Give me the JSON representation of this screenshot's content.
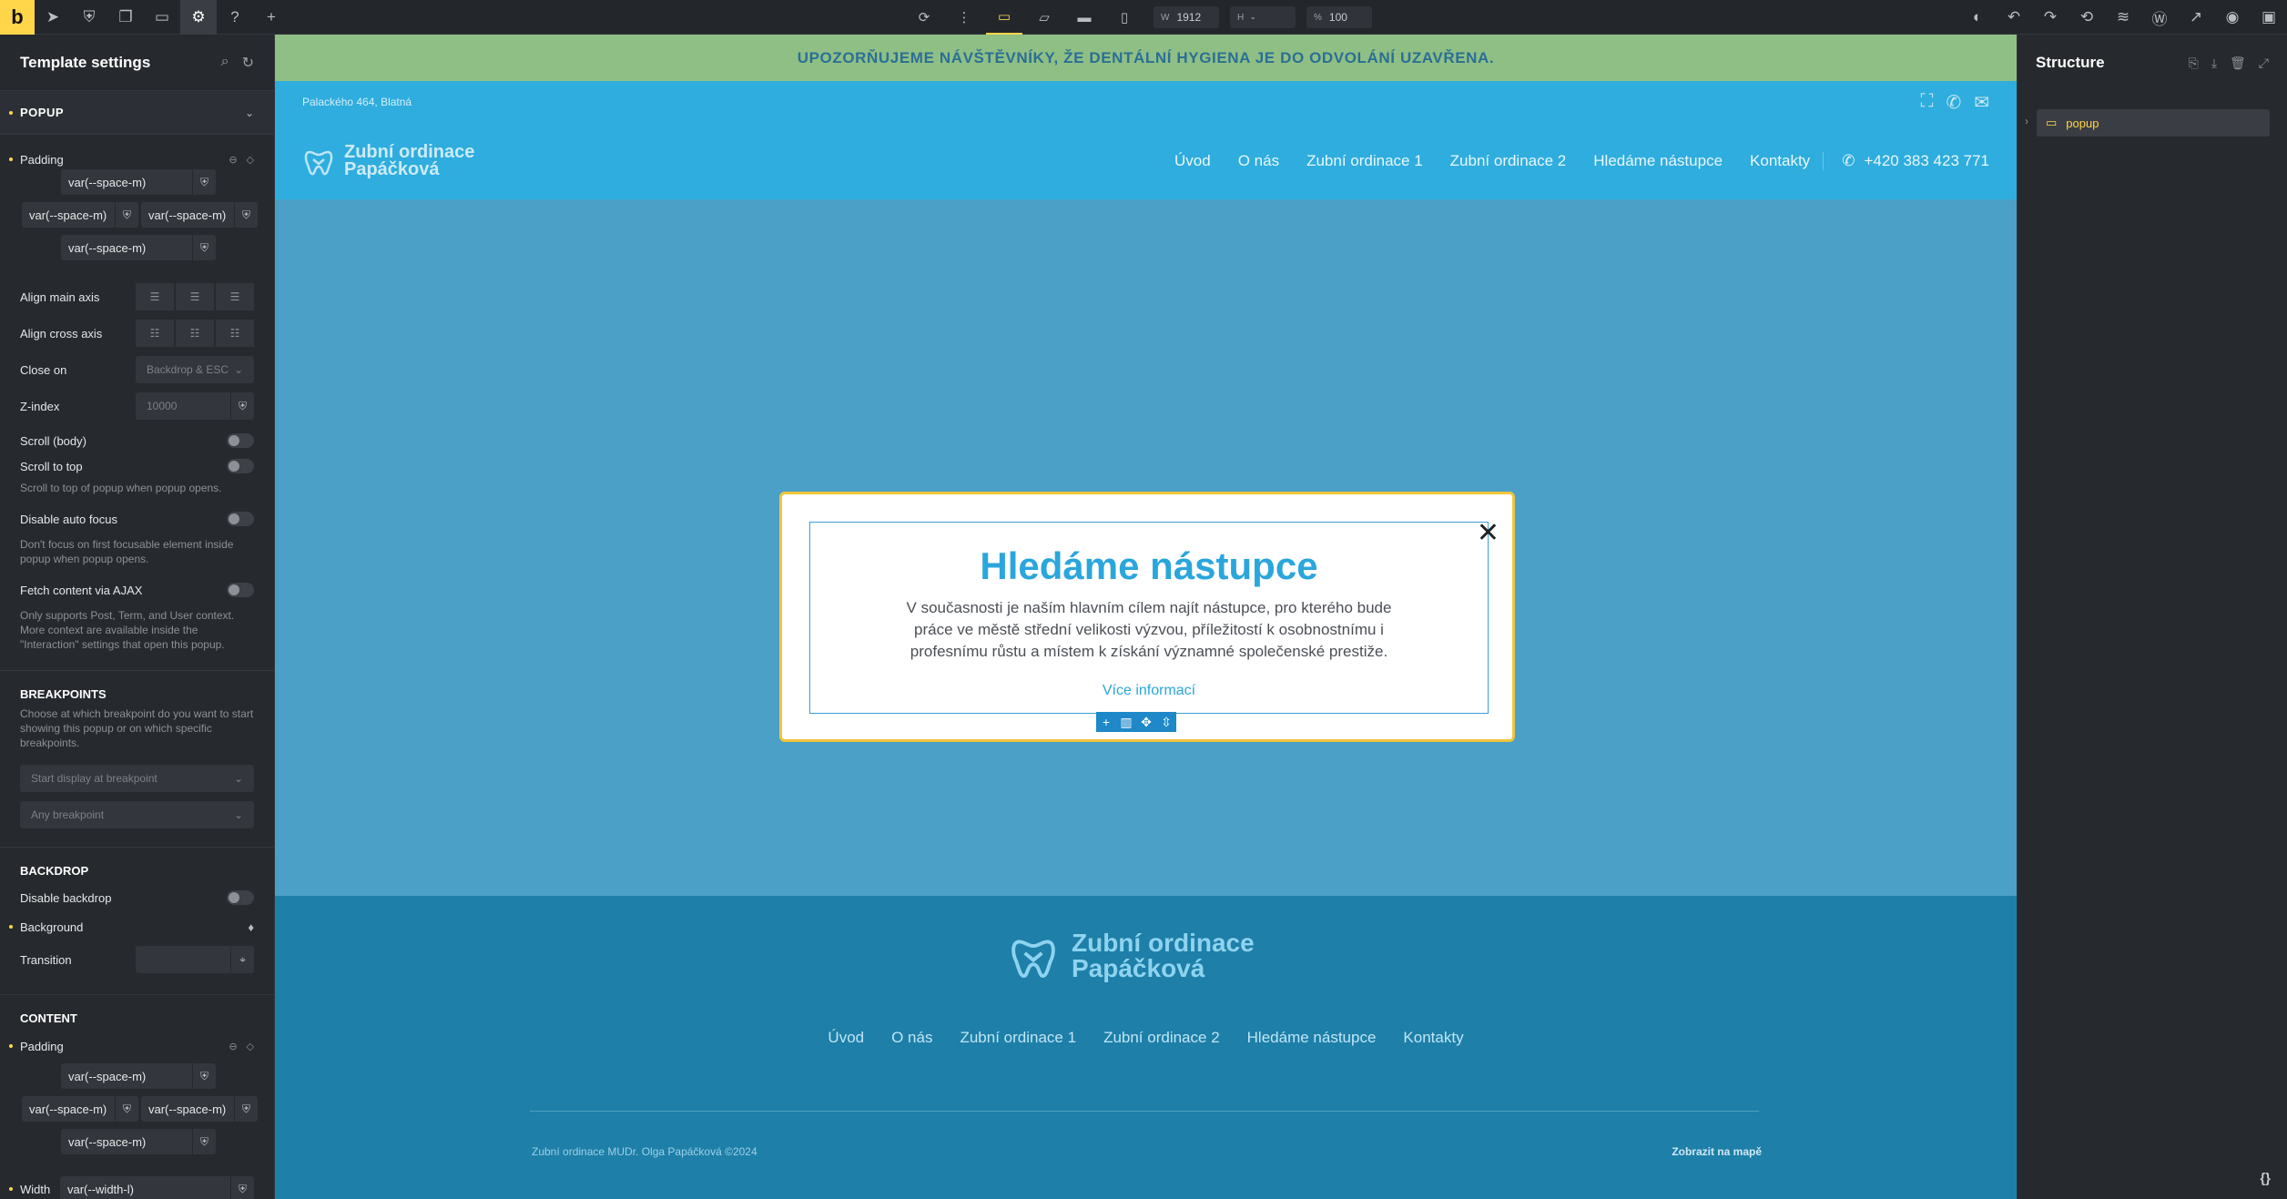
{
  "toolbar": {
    "logo": "b",
    "width_label": "W",
    "width_value": "1912",
    "height_label": "H",
    "height_value": "-",
    "zoom_label": "%",
    "zoom_value": "100"
  },
  "left_panel": {
    "title": "Template settings",
    "popup_section": "POPUP",
    "padding_label": "Padding",
    "padding_values": [
      "var(--space-m)",
      "var(--space-m)",
      "var(--space-m)",
      "var(--space-m)"
    ],
    "align_main_label": "Align main axis",
    "align_cross_label": "Align cross axis",
    "close_on_label": "Close on",
    "close_on_value": "Backdrop & ESC",
    "zindex_label": "Z-index",
    "zindex_placeholder": "10000",
    "scroll_body_label": "Scroll (body)",
    "scroll_top_label": "Scroll to top",
    "scroll_top_desc": "Scroll to top of popup when popup opens.",
    "disable_focus_label": "Disable auto focus",
    "disable_focus_desc": "Don't focus on first focusable element inside popup when popup opens.",
    "fetch_ajax_label": "Fetch content via AJAX",
    "fetch_ajax_desc": "Only supports Post, Term, and User context. More context are available inside the \"Interaction\" settings that open this popup.",
    "breakpoints_title": "BREAKPOINTS",
    "breakpoints_desc": "Choose at which breakpoint do you want to start showing this popup or on which specific breakpoints.",
    "start_breakpoint_placeholder": "Start display at breakpoint",
    "any_breakpoint_placeholder": "Any breakpoint",
    "backdrop_title": "BACKDROP",
    "disable_backdrop_label": "Disable backdrop",
    "background_label": "Background",
    "transition_label": "Transition",
    "content_title": "CONTENT",
    "content_padding_label": "Padding",
    "content_padding_values": [
      "var(--space-m)",
      "var(--space-m)",
      "var(--space-m)",
      "var(--space-m)"
    ],
    "width_label": "Width",
    "width_value": "var(--width-l)"
  },
  "site": {
    "notice": "UPOZORŇUJEME NÁVŠTĚVNÍKY, ŽE DENTÁLNÍ HYGIENA JE DO ODVOLÁNÍ UZAVŘENA.",
    "address": "Palackého 464, Blatná",
    "brand_line1": "Zubní ordinace",
    "brand_line2": "Papáčková",
    "menu": [
      "Úvod",
      "O nás",
      "Zubní ordinace 1",
      "Zubní ordinace 2",
      "Hledáme nástupce",
      "Kontakty"
    ],
    "phone": "+420 383 423 771",
    "popup_title": "Hledáme nástupce",
    "popup_text": "V současnosti je naším hlavním cílem najít nástupce, pro kterého bude práce ve městě střední velikosti výzvou, příležitostí k osobnostnímu i profesnímu růstu a místem k získání významné společenské prestiže.",
    "popup_link": "Více informací",
    "footer_brand_line1": "Zubní ordinace",
    "footer_brand_line2": "Papáčková",
    "footer_menu": [
      "Úvod",
      "O nás",
      "Zubní ordinace 1",
      "Zubní ordinace 2",
      "Hledáme nástupce",
      "Kontakty"
    ],
    "footer_copy": "Zubní ordinace MUDr. Olga Papáčková ©2024",
    "footer_map": "Zobrazit na mapě"
  },
  "right_panel": {
    "title": "Structure",
    "tree_item": "popup",
    "bottom_icon": "{}"
  },
  "colors": {
    "accent": "#ffd54a",
    "site_blue": "#2eadde",
    "notice_green": "#8fbf84",
    "footer_blue": "#1e7fa8"
  }
}
